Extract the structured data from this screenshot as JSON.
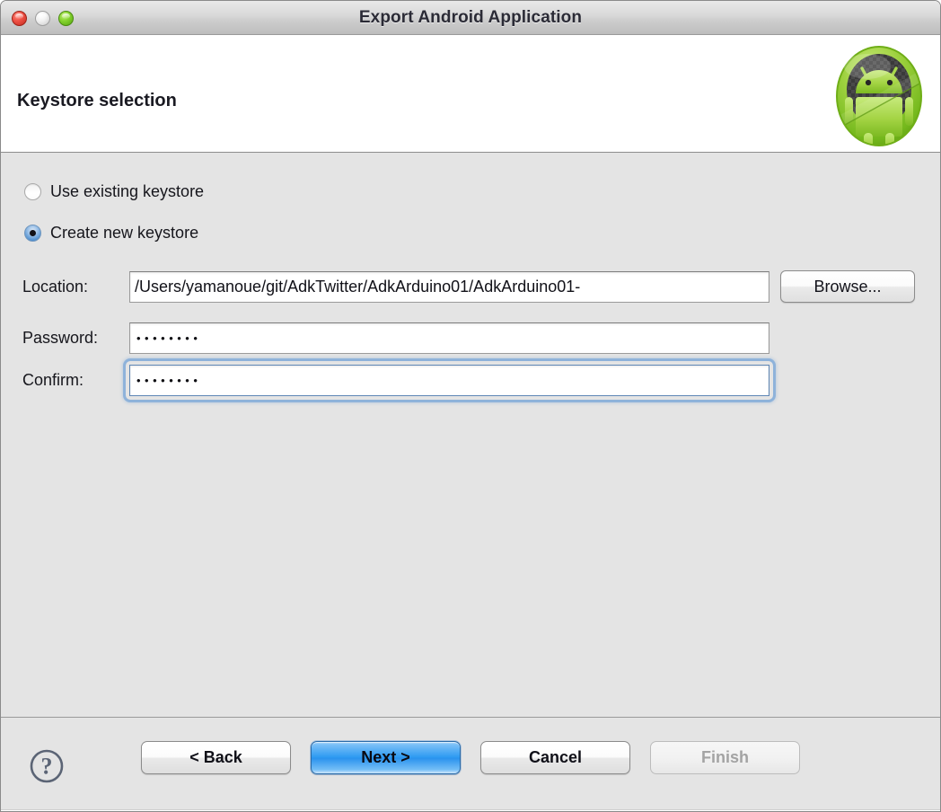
{
  "window": {
    "title": "Export Android Application",
    "traffic_lights": [
      {
        "name": "close",
        "color": "#ef5145"
      },
      {
        "name": "minimize",
        "color": "#f0f0f0"
      },
      {
        "name": "zoom",
        "color": "#86d42f"
      }
    ]
  },
  "header": {
    "title": "Keystore selection",
    "icon": "android-robot-icon"
  },
  "content": {
    "radios": [
      {
        "label": "Use existing keystore",
        "selected": false
      },
      {
        "label": "Create new keystore",
        "selected": true
      }
    ],
    "fields": [
      {
        "label": "Location:",
        "value": "/Users/yamanoue/git/AdkTwitter/AdkArduino01/AdkArduino01-",
        "placeholder": "",
        "type": "text",
        "focused": false
      },
      {
        "label": "Password:",
        "value": "••••••••",
        "placeholder": "",
        "type": "password",
        "focused": false
      },
      {
        "label": "Confirm:",
        "value": "••••••••",
        "placeholder": "",
        "type": "password",
        "focused": true
      }
    ],
    "browse_label": "Browse..."
  },
  "footer": {
    "help_glyph": "?",
    "buttons": [
      {
        "label": "< Back",
        "state": "normal"
      },
      {
        "label": "Next >",
        "state": "default"
      },
      {
        "label": "Cancel",
        "state": "normal"
      },
      {
        "label": "Finish",
        "state": "disabled"
      }
    ]
  },
  "colors": {
    "accent_blue": "#2f9bf2",
    "content_bg": "#e4e4e4",
    "header_bg": "#ffffff",
    "android_green": "#86d42f"
  }
}
